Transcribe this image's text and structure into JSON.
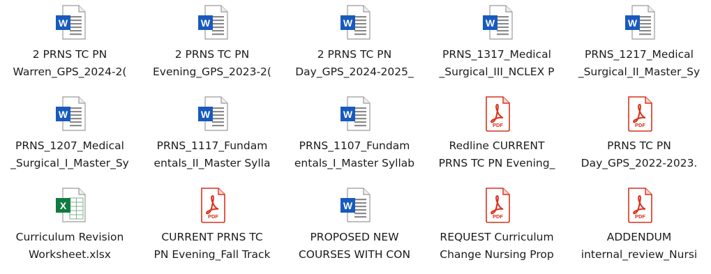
{
  "files": [
    {
      "type": "word",
      "icon": "word-document-icon",
      "name_line1": "2 PRNS TC PN",
      "name_line2": "Warren_GPS_2024-2("
    },
    {
      "type": "word",
      "icon": "word-document-icon",
      "name_line1": "2 PRNS TC PN",
      "name_line2": "Evening_GPS_2023-2("
    },
    {
      "type": "word",
      "icon": "word-document-icon",
      "name_line1": "2 PRNS TC PN",
      "name_line2": "Day_GPS_2024-2025_"
    },
    {
      "type": "word",
      "icon": "word-document-icon",
      "name_line1": "PRNS_1317_Medical",
      "name_line2": "_Surgical_III_NCLEX P"
    },
    {
      "type": "word",
      "icon": "word-document-icon",
      "name_line1": "PRNS_1217_Medical",
      "name_line2": "_Surgical_II_Master_Sy"
    },
    {
      "type": "word",
      "icon": "word-document-icon",
      "name_line1": "PRNS_1207_Medical",
      "name_line2": "_Surgical_I_Master_Sy"
    },
    {
      "type": "word",
      "icon": "word-document-icon",
      "name_line1": "PRNS_1117_Fundam",
      "name_line2": "entals_II_Master Sylla"
    },
    {
      "type": "word",
      "icon": "word-document-icon",
      "name_line1": "PRNS_1107_Fundam",
      "name_line2": "entals_I_Master Syllab"
    },
    {
      "type": "pdf",
      "icon": "pdf-document-icon",
      "badge": "PDF",
      "name_line1": "Redline CURRENT",
      "name_line2": "PRNS TC PN Evening_"
    },
    {
      "type": "pdf",
      "icon": "pdf-document-icon",
      "badge": "PDF",
      "name_line1": "PRNS TC PN",
      "name_line2": "Day_GPS_2022-2023."
    },
    {
      "type": "excel",
      "icon": "excel-spreadsheet-icon",
      "name_line1": "Curriculum Revision",
      "name_line2": "Worksheet.xlsx"
    },
    {
      "type": "pdf",
      "icon": "pdf-document-icon",
      "badge": "PDF",
      "name_line1": "CURRENT PRNS TC",
      "name_line2": "PN Evening_Fall Track"
    },
    {
      "type": "word",
      "icon": "word-document-icon",
      "name_line1": "PROPOSED NEW",
      "name_line2": "COURSES WITH CON"
    },
    {
      "type": "pdf",
      "icon": "pdf-document-icon",
      "badge": "PDF",
      "name_line1": "REQUEST Curriculum",
      "name_line2": "Change Nursing Prop"
    },
    {
      "type": "pdf",
      "icon": "pdf-document-icon",
      "badge": "PDF",
      "name_line1": "ADDENDUM",
      "name_line2": "internal_review_Nursi"
    }
  ],
  "colors": {
    "word_blue": "#185abd",
    "excel_green": "#107c41",
    "pdf_red": "#d9311c",
    "text": "#1b1b1b"
  }
}
